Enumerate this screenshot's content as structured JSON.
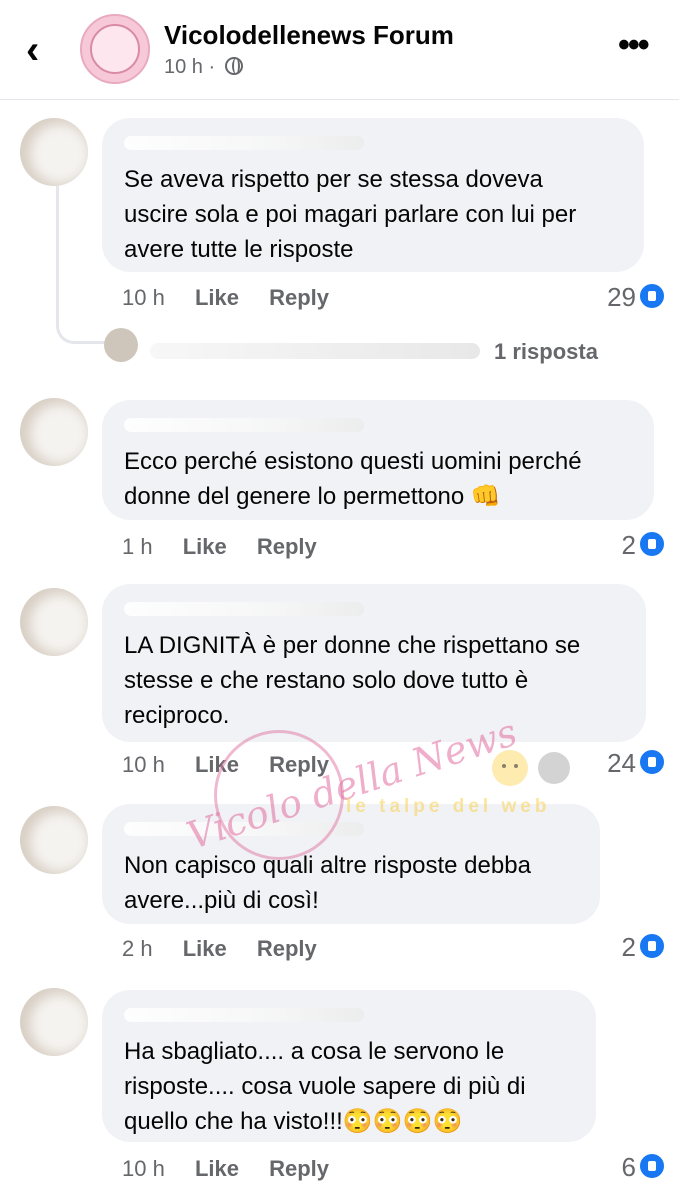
{
  "header": {
    "back_icon": "chevron-left-icon",
    "page_name": "Vicolodellenews Forum",
    "time": "10 h",
    "audience_icon": "globe-icon",
    "more_icon": "more-horizontal-icon"
  },
  "comments": [
    {
      "text": "Se aveva rispetto per se stessa doveva\nuscire sola e poi magari parlare con lui per\navere tutte le risposte",
      "time": "10 h",
      "like_label": "Like",
      "reply_label": "Reply",
      "reaction_count": "29"
    },
    {
      "text": "Ecco perché esistono questi uomini perché\ndonne del genere lo permettono 👊",
      "time": "1 h",
      "like_label": "Like",
      "reply_label": "Reply",
      "reaction_count": "2"
    },
    {
      "text": "LA DIGNITÀ è per donne che rispettano se\nstesse e che restano solo dove tutto è\nreciproco.",
      "time": "10 h",
      "like_label": "Like",
      "reply_label": "Reply",
      "reaction_count": "24"
    },
    {
      "text": "Non capisco quali altre risposte debba\navere...più di così!",
      "time": "2 h",
      "like_label": "Like",
      "reply_label": "Reply",
      "reaction_count": "2"
    },
    {
      "text": "Ha sbagliato.... a cosa le servono le\nrisposte.... cosa vuole sapere di più di\nquello che ha visto!!!😳😳😳😳",
      "time": "10 h",
      "like_label": "Like",
      "reply_label": "Reply",
      "reaction_count": "6"
    }
  ],
  "reply_thread": {
    "label": "1 risposta"
  },
  "watermark": {
    "logo_text": "Vicolo della News",
    "subtext": "le talpe del web"
  },
  "colors": {
    "bubble": "#f0f2f5",
    "meta_text": "#65676b",
    "like_blue": "#1877f2"
  }
}
